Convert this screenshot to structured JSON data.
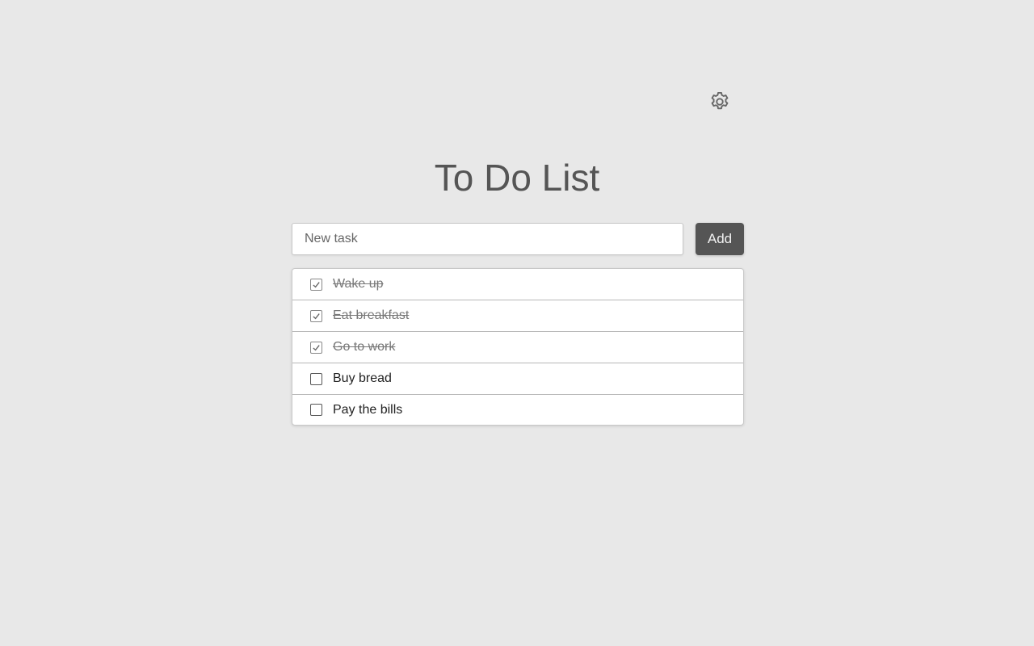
{
  "header": {
    "title": "To Do List",
    "settings_icon": "gear-icon"
  },
  "new_task": {
    "placeholder": "New task",
    "value": "",
    "add_label": "Add"
  },
  "tasks": [
    {
      "label": "Wake up",
      "done": true
    },
    {
      "label": "Eat breakfast",
      "done": true
    },
    {
      "label": "Go to work",
      "done": true
    },
    {
      "label": "Buy bread",
      "done": false
    },
    {
      "label": "Pay the bills",
      "done": false
    }
  ],
  "colors": {
    "background": "#e8e8e8",
    "title": "#555555",
    "button": "#555555",
    "done_text": "#777777"
  }
}
